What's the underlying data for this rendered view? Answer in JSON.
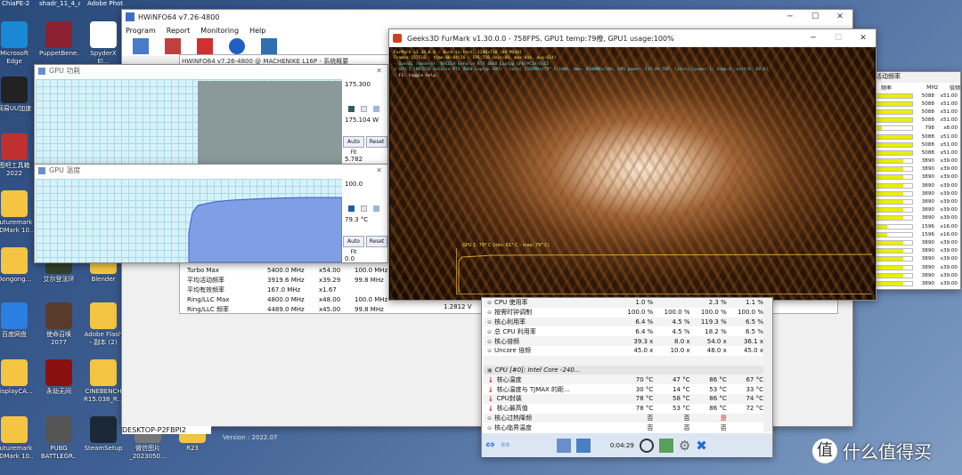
{
  "desktop": {
    "icons": [
      {
        "label": "Microsoft Edge",
        "icon": "edge-icon",
        "color": "#1b88d6"
      },
      {
        "label": "PuppetBene...",
        "icon": "app-icon",
        "color": "#8c2030"
      },
      {
        "label": "SpyderX El...",
        "icon": "spyder-icon",
        "color": "#ffffff"
      },
      {
        "label": "网易UU加速",
        "icon": "uu-icon",
        "color": "#222222"
      },
      {
        "label": "图吧工具箱 2022",
        "icon": "toolbox-icon",
        "color": "#c03030"
      },
      {
        "label": "Futuremark 3DMark 10..",
        "icon": "folder-icon",
        "color": "#f4c542"
      },
      {
        "label": "Dongong...",
        "icon": "folder-icon",
        "color": "#f4c542"
      },
      {
        "label": "艾尔登法环",
        "icon": "game-icon",
        "color": "#33402a"
      },
      {
        "label": "Blender",
        "icon": "folder-icon",
        "color": "#f4c542"
      },
      {
        "label": "百度网盘",
        "icon": "baidu-icon",
        "color": "#2a7fe0"
      },
      {
        "label": "使命召唤 2077",
        "icon": "game-icon",
        "color": "#5a3a2a"
      },
      {
        "label": "Adobe Flash - 副本 (2)",
        "icon": "folder-icon",
        "color": "#f4c542"
      },
      {
        "label": "displayCA...",
        "icon": "folder-icon",
        "color": "#f4c542"
      },
      {
        "label": "永劫无间",
        "icon": "game-icon",
        "color": "#8a1010"
      },
      {
        "label": "CINEBENCH R15.038_R...",
        "icon": "folder-icon",
        "color": "#f4c542"
      },
      {
        "label": "Futuremark 3DMark 10..",
        "icon": "folder-icon",
        "color": "#f4c542"
      },
      {
        "label": "PUBG BATTLEGR..",
        "icon": "game-icon",
        "color": "#555555"
      },
      {
        "label": "SteamSetup",
        "icon": "steam-icon",
        "color": "#1b2838"
      },
      {
        "label": "微信图片_2023050...",
        "icon": "image-icon",
        "color": "#777777"
      },
      {
        "label": "R23",
        "icon": "folder-icon",
        "color": "#f4c542"
      }
    ],
    "top_labels": [
      "ChiaPE-2",
      "shadr_11_4_aeplugins-...",
      "Adobe Photosho...",
      "SpyderX Elite-...",
      "Edge"
    ]
  },
  "hwinfo_main": {
    "title": "HWiNFO64 v7.26-4800",
    "menu": [
      "Program",
      "Report",
      "Monitoring",
      "Help"
    ],
    "subtitle": "HWiNFO64 v7.26-4800 @ MACHENIKE L16P - 系统概要",
    "rows": [
      [
        "Turbo Max",
        "5400.0 MHz",
        "x54.00",
        "100.0 MHz"
      ],
      [
        "平均活动频率",
        "3919.6 MHz",
        "x39.29",
        "99.8 MHz"
      ],
      [
        "平均有效频率",
        "167.0 MHz",
        "x1.67",
        ""
      ],
      [
        "Ring/LLC Max",
        "4800.0 MHz",
        "x48.00",
        "100.0 MHz"
      ],
      [
        "Ring/LLC 频率",
        "4489.0 MHz",
        "x45.00",
        "99.8 MHz"
      ]
    ],
    "voltage": "1.2812 V",
    "computer": "DESKTOP-P2FBPI2",
    "version": "Version : 2022.07"
  },
  "power_graph": {
    "title": "GPU 功耗",
    "max": "175.300",
    "current": "175.104 W",
    "min": "5.782",
    "autofit": "Auto Fit",
    "reset": "Reset"
  },
  "temp_graph": {
    "title": "GPU 温度",
    "max": "100.0",
    "current": "79.3 °C",
    "min": "0.0",
    "autofit": "Auto Fit",
    "reset": "Reset"
  },
  "furmark": {
    "title": "Geeks3D FurMark v1.30.0.0 - 758FPS, GPU1 temp:79癈, GPU1 usage:100%",
    "osd": [
      "FurMark v1.30.0.0 - Burn-in test, 1280x720 (0X MSAA)",
      "Frames:157516 - time:00:04:16 - FPS:758 (min:88, max:844, avg:614)",
      "- OpenGL renderer: NVIDIA GeForce RTX 4060 Laptop GPU/PCIe/SSE2",
      "> GPU 1 (NVIDIA GeForce RTX 4060 Laptop GPU) - core: 2565MHz/79° C/100%, mem: 8500MHz/16%, GPU power: 115.9% TDP, limits:[power:1, temp:0, volt:0, OV:0]",
      "- F1: toggle help"
    ],
    "temp_label": "GPU 1: 79° C (min: 61° C - max: 79° C)"
  },
  "sensors": {
    "headers": [
      "",
      "",
      "",
      ""
    ],
    "rows": [
      {
        "name": "CPU 使用率",
        "cols": [
          "1.0 %",
          "",
          "2.3 %",
          "1.1 %"
        ],
        "icon": "minus-circle-icon"
      },
      {
        "name": "按需时钟调制",
        "cols": [
          "100.0 %",
          "100.0 %",
          "100.0 %",
          "100.0 %"
        ],
        "icon": "minus-circle-icon"
      },
      {
        "name": "核心利用率",
        "cols": [
          "6.4 %",
          "4.5 %",
          "119.3 %",
          "6.5 %"
        ],
        "icon": "minus-circle-icon"
      },
      {
        "name": "总 CPU 利用率",
        "cols": [
          "6.4 %",
          "4.5 %",
          "18.2 %",
          "6.5 %"
        ],
        "icon": "minus-circle-icon"
      },
      {
        "name": "核心倍频",
        "cols": [
          "39.3 x",
          "8.0 x",
          "54.0 x",
          "36.1 x"
        ],
        "icon": "minus-circle-icon"
      },
      {
        "name": "Uncore 倍频",
        "cols": [
          "45.0 x",
          "10.0 x",
          "48.0 x",
          "45.0 x"
        ],
        "icon": "minus-circle-icon"
      },
      {
        "name": "",
        "cols": [
          "",
          "",
          "",
          ""
        ],
        "icon": ""
      },
      {
        "name": "CPU [#0]: Intel Core -240...",
        "cols": [
          "",
          "",
          "",
          ""
        ],
        "icon": "chip-icon"
      },
      {
        "name": "核心温度",
        "cols": [
          "70 °C",
          "47 °C",
          "86 °C",
          "67 °C"
        ],
        "icon": "thermometer-icon"
      },
      {
        "name": "核心温度与 TJMAX 的距...",
        "cols": [
          "30 °C",
          "14 °C",
          "53 °C",
          "33 °C"
        ],
        "icon": "thermometer-icon"
      },
      {
        "name": "CPU封装",
        "cols": [
          "78 °C",
          "58 °C",
          "86 °C",
          "74 °C"
        ],
        "icon": "thermometer-icon"
      },
      {
        "name": "核心最高值",
        "cols": [
          "78 °C",
          "53 °C",
          "86 °C",
          "72 °C"
        ],
        "icon": "thermometer-icon"
      },
      {
        "name": "核心过热降频",
        "cols": [
          "否",
          "否",
          "是",
          ""
        ],
        "icon": "minus-circle-icon"
      },
      {
        "name": "核心临界温度",
        "cols": [
          "否",
          "否",
          "否",
          ""
        ],
        "icon": "minus-circle-icon"
      }
    ],
    "timer": "0:04:29"
  },
  "freq_panel": {
    "title": "活动频率",
    "col_freq": "频率",
    "col_mhz": "MHz",
    "col_ratio": "倍频",
    "rows": [
      [
        "5088",
        "x51.00",
        1
      ],
      [
        "5088",
        "x51.00",
        1
      ],
      [
        "5088",
        "x51.00",
        1
      ],
      [
        "5088",
        "x51.00",
        1
      ],
      [
        "798",
        "x8.00",
        0.15
      ],
      [
        "5088",
        "x51.00",
        1
      ],
      [
        "5088",
        "x51.00",
        1
      ],
      [
        "5088",
        "x51.00",
        1
      ],
      [
        "3890",
        "x39.00",
        0.75
      ],
      [
        "3890",
        "x39.00",
        0.75
      ],
      [
        "3890",
        "x39.00",
        0.75
      ],
      [
        "3890",
        "x39.00",
        0.75
      ],
      [
        "3890",
        "x39.00",
        0.75
      ],
      [
        "3890",
        "x39.00",
        0.75
      ],
      [
        "3890",
        "x39.00",
        0.75
      ],
      [
        "3890",
        "x39.00",
        0.75
      ],
      [
        "1596",
        "x16.00",
        0.3
      ],
      [
        "1596",
        "x16.00",
        0.3
      ],
      [
        "3890",
        "x39.00",
        0.75
      ],
      [
        "3890",
        "x39.00",
        0.75
      ],
      [
        "3890",
        "x39.00",
        0.75
      ],
      [
        "3890",
        "x39.00",
        0.75
      ],
      [
        "3890",
        "x39.00",
        0.75
      ],
      [
        "3890",
        "x39.00",
        0.75
      ]
    ]
  },
  "watermark": "什么值得买",
  "colors": {
    "accent": "#1e6fd0",
    "furmark_text": "#e8e86a",
    "temp_line": "#d8a030"
  }
}
